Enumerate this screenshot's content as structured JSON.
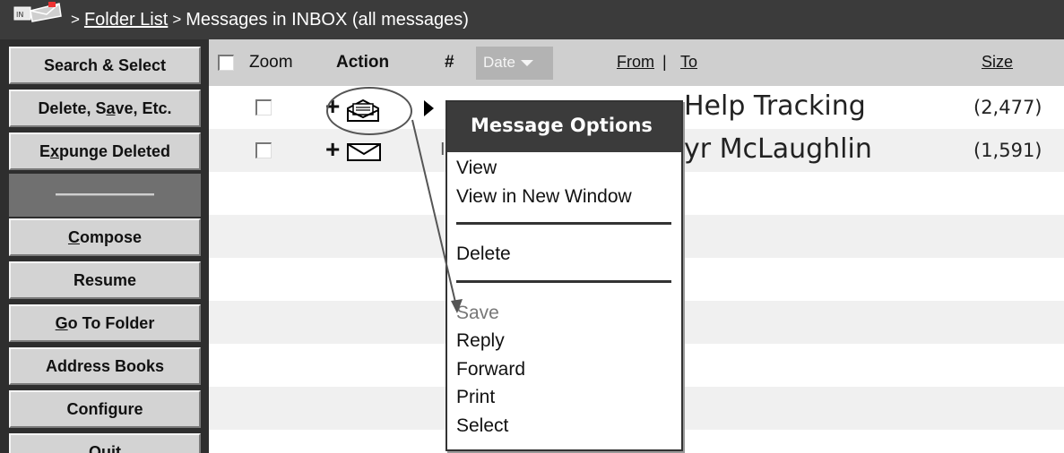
{
  "breadcrumb": {
    "separator": ">",
    "folder_list": "Folder List",
    "current": "Messages in INBOX (all messages)"
  },
  "sidebar": {
    "search_select": "Search & Select",
    "delete_save": [
      "Delete, S",
      "a",
      "ve, Etc."
    ],
    "expunge": [
      "E",
      "x",
      "punge Deleted"
    ],
    "compose": [
      "",
      "C",
      "ompose"
    ],
    "resume": "Resume",
    "go_to_folder": [
      "",
      "G",
      "o To Folder"
    ],
    "address_books": "Address Books",
    "configure": "Configure",
    "quit": "Quit"
  },
  "table": {
    "headers": {
      "zoom": "Zoom",
      "action": "Action",
      "number": "#",
      "date": "Date",
      "from": "From",
      "separator": "|",
      "to": "To",
      "size": "Size"
    },
    "rows": [
      {
        "from": "Help Tracking",
        "size": "(2,477)",
        "icon": "open-envelope-icon"
      },
      {
        "from": "yr McLaughlin",
        "size": "(1,591)",
        "icon": "envelope-icon"
      }
    ]
  },
  "menu": {
    "title": "Message Options",
    "items": [
      "View",
      "View in New Window",
      "Delete",
      "Save",
      "Reply",
      "Forward",
      "Print",
      "Select"
    ]
  },
  "colors": {
    "topbar": "#3b3b3b",
    "sidebar_button": "#d3d3d3",
    "header_row": "#cfcfcf",
    "alt_row": "#f0f0f0"
  }
}
